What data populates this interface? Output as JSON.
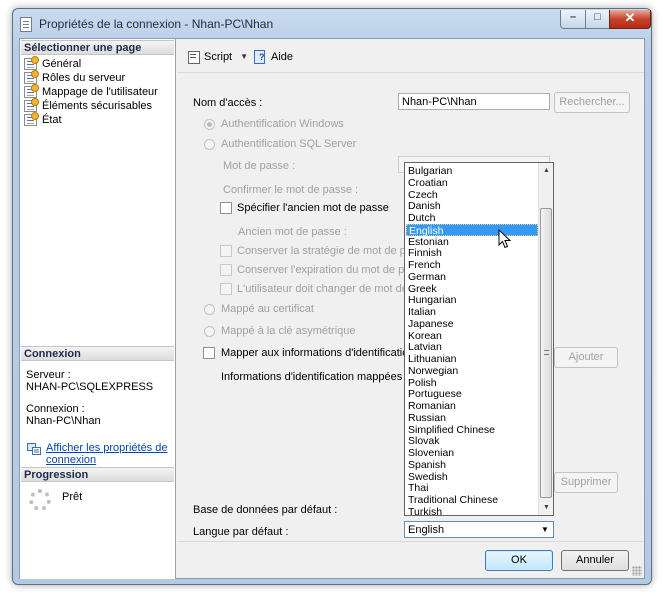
{
  "window": {
    "title": "Propriétés de la connexion - Nhan-PC\\Nhan",
    "controls": {
      "minimize": "–",
      "maximize": "□",
      "close": "✕"
    }
  },
  "left_panel": {
    "select_page_header": "Sélectionner une page",
    "pages": [
      {
        "label": "Général",
        "icon": "page-icon"
      },
      {
        "label": "Rôles du serveur",
        "icon": "page-icon"
      },
      {
        "label": "Mappage de l'utilisateur",
        "icon": "page-icon"
      },
      {
        "label": "Éléments sécurisables",
        "icon": "page-icon"
      },
      {
        "label": "État",
        "icon": "page-icon"
      }
    ],
    "connection_header": "Connexion",
    "server_label": "Serveur :",
    "server_value": "NHAN-PC\\SQLEXPRESS",
    "connection_label": "Connexion :",
    "connection_value": "Nhan-PC\\Nhan",
    "view_properties_link": "Afficher les propriétés de connexion",
    "progress_header": "Progression",
    "progress_status": "Prêt"
  },
  "toolbar": {
    "script_label": "Script",
    "help_label": "Aide"
  },
  "form": {
    "login_name_label": "Nom d'accès :",
    "login_name_value": "Nhan-PC\\Nhan",
    "search_button": "Rechercher...",
    "windows_auth": "Authentification Windows",
    "sql_auth": "Authentification SQL Server",
    "password_label": "Mot de passe :",
    "confirm_password_label": "Confirmer le mot de passe :",
    "specify_old_password": "Spécifier l'ancien mot de passe",
    "old_password_label": "Ancien mot de passe :",
    "enforce_policy": "Conserver la stratégie de mot de passe",
    "enforce_expiration": "Conserver l'expiration du mot de passe",
    "must_change": "L'utilisateur doit changer de mot de passe",
    "mapped_certificate": "Mappé au certificat",
    "mapped_asymmetric_key": "Mappé à la clé asymétrique",
    "map_credential": "Mapper aux informations d'identification",
    "mapped_credentials": "Informations d'identification mappées",
    "add_button": "Ajouter",
    "remove_button": "Supprimer",
    "default_database_label": "Base de données par défaut :",
    "default_language_label": "Langue par défaut :",
    "default_language_value": "English"
  },
  "language_dropdown": {
    "selected": "English",
    "options": [
      "Bulgarian",
      "Croatian",
      "Czech",
      "Danish",
      "Dutch",
      "English",
      "Estonian",
      "Finnish",
      "French",
      "German",
      "Greek",
      "Hungarian",
      "Italian",
      "Japanese",
      "Korean",
      "Latvian",
      "Lithuanian",
      "Norwegian",
      "Polish",
      "Portuguese",
      "Romanian",
      "Russian",
      "Simplified Chinese",
      "Slovak",
      "Slovenian",
      "Spanish",
      "Swedish",
      "Thai",
      "Traditional Chinese",
      "Turkish"
    ]
  },
  "footer": {
    "ok_button": "OK",
    "cancel_button": "Annuler"
  }
}
